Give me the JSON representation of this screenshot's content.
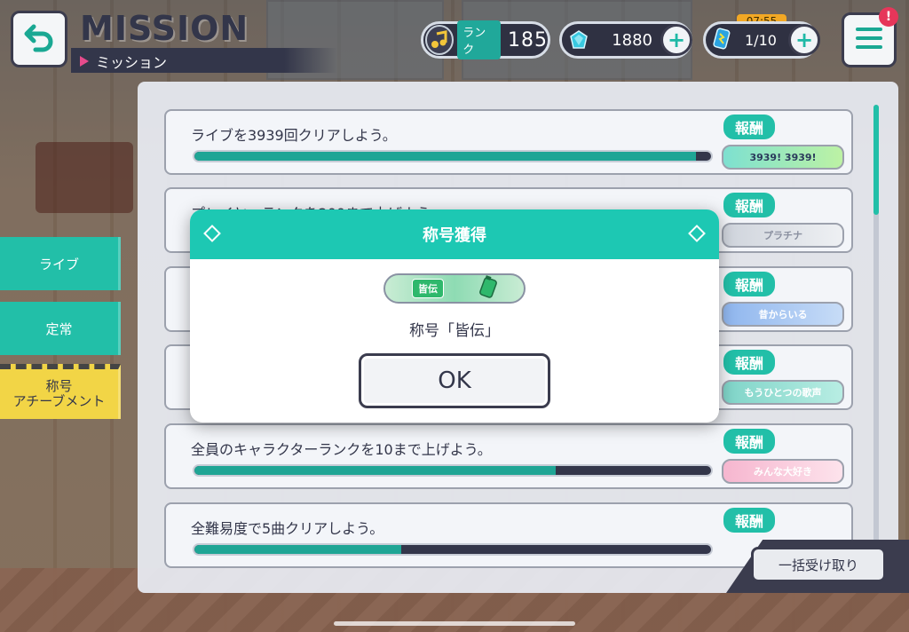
{
  "header": {
    "title": "MISSION",
    "subtitle": "ミッション",
    "rank_label": "ランク",
    "rank_value": "185",
    "crystal_value": "1880",
    "energy_value": "1/10",
    "energy_timer": "07:55",
    "notification": "!"
  },
  "side_tabs": [
    {
      "label": "ライブ"
    },
    {
      "label": "定常"
    },
    {
      "label": "称号\nアチーブメント"
    }
  ],
  "reward_label": "報酬",
  "missions": [
    {
      "text": "ライブを3939回クリアしよう。",
      "progress": 0.97,
      "reward": "3939!  3939!"
    },
    {
      "text": "プレイヤーランクを200まで上げよう。",
      "progress": 0.0,
      "reward": "プラチナ"
    },
    {
      "text": "",
      "progress": 0.0,
      "reward": "昔からいる"
    },
    {
      "text": "",
      "progress": 0.0,
      "reward": "もうひとつの歌声"
    },
    {
      "text": "全員のキャラクターランクを10まで上げよう。",
      "progress": 0.7,
      "reward": "みんな大好き"
    },
    {
      "text": "全難易度で5曲クリアしよう。",
      "progress": 0.4,
      "reward": ""
    }
  ],
  "collect_all": "一括受け取り",
  "modal": {
    "title": "称号獲得",
    "plate_tag": "皆伝",
    "message": "称号「皆伝」",
    "ok_label": "OK"
  },
  "colors": {
    "accent": "#1dc8b3",
    "dark": "#33364a",
    "active_tab": "#f2d546"
  }
}
